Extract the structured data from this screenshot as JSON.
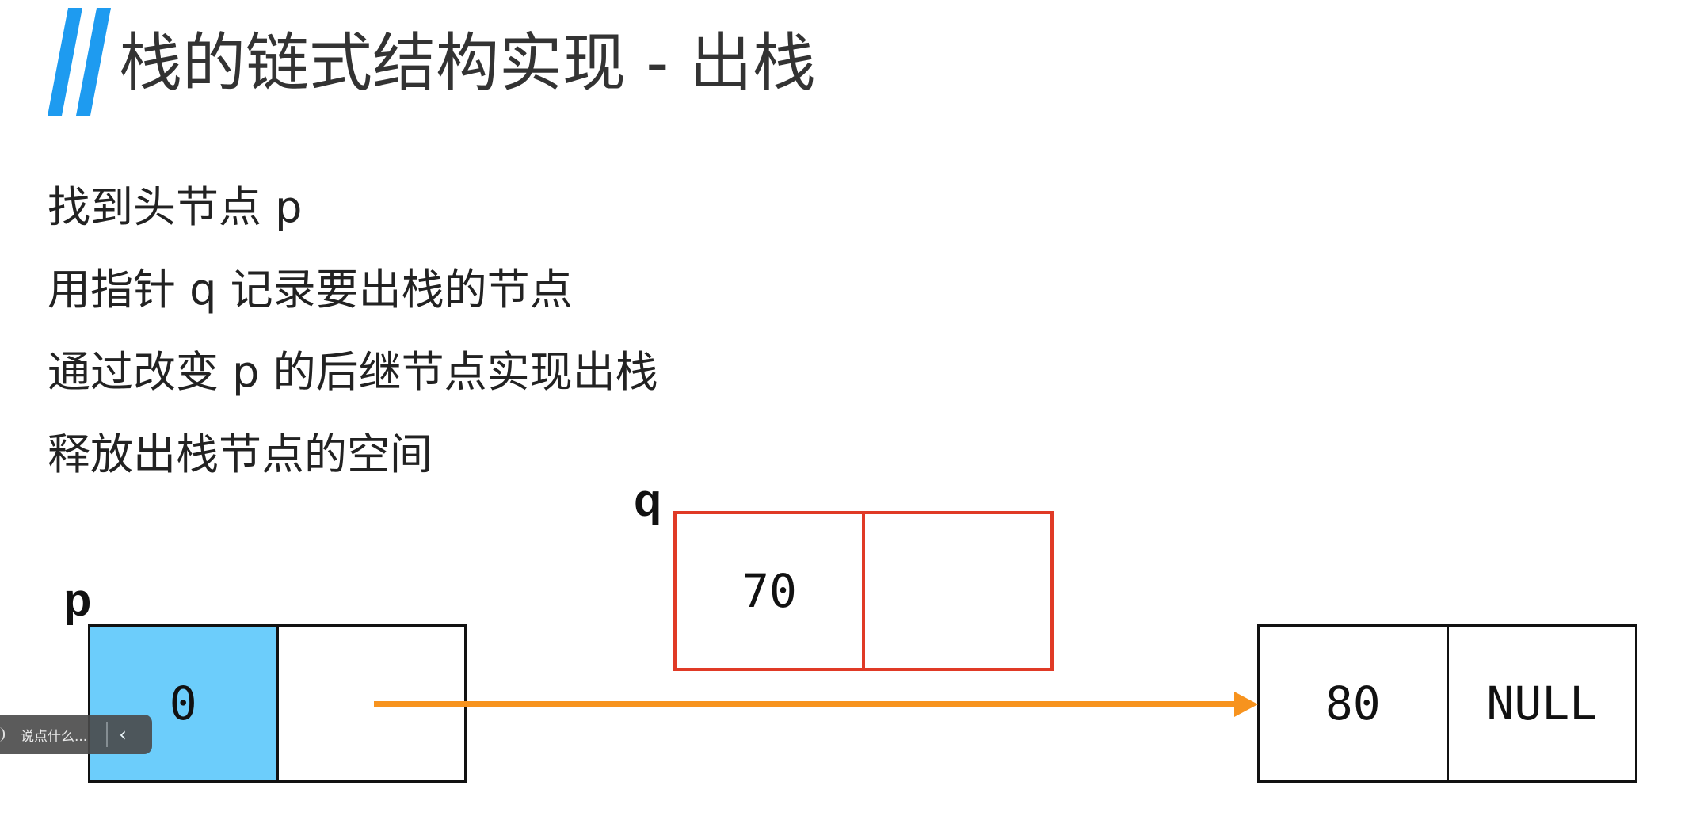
{
  "slide": {
    "title": "栈的链式结构实现 - 出栈",
    "accent_color": "#1e9bf0",
    "bullets": [
      "找到头节点 p",
      "用指针 q 记录要出栈的节点",
      "通过改变 p 的后继节点实现出栈",
      "释放出栈节点的空间"
    ]
  },
  "diagram": {
    "pointer_p": "p",
    "pointer_q": "q",
    "node_p": {
      "data": "0",
      "next": "",
      "color": "#6ccdfb"
    },
    "node_q": {
      "data": "70",
      "next": "",
      "color": "#e03a26"
    },
    "node_tail": {
      "data": "80",
      "next": "NULL"
    },
    "arrow_color": "#f7931e"
  },
  "player": {
    "comment_placeholder": "说点什么...",
    "collapse_icon": "chevron-left-icon"
  }
}
